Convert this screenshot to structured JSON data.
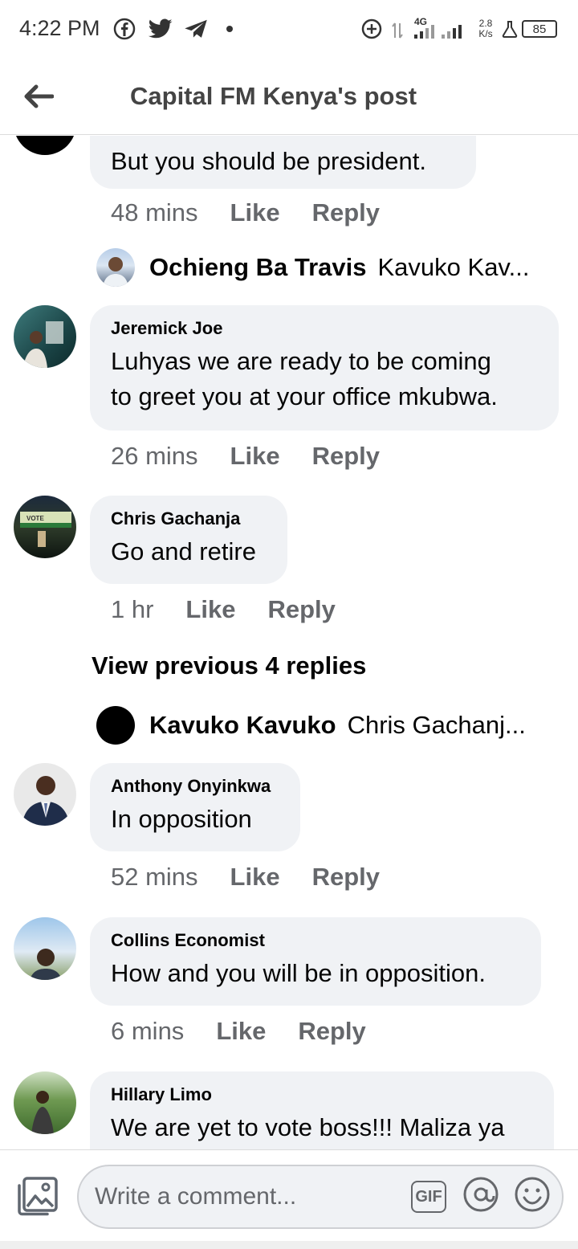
{
  "status_bar": {
    "time": "4:22 PM",
    "network": "4G",
    "speed_value": "2.8",
    "speed_unit": "K/s",
    "battery": "85",
    "icons": [
      "facebook-icon",
      "twitter-icon",
      "telegram-icon",
      "notification-dot-icon",
      "data-saver-icon",
      "signal-icon",
      "lab-icon",
      "battery-icon"
    ]
  },
  "header": {
    "title": "Capital FM Kenya's post",
    "back_icon": "arrow-left-icon"
  },
  "comments": [
    {
      "author": "",
      "text": "But you should be president.",
      "time": "48 mins",
      "like": "Like",
      "reply": "Reply",
      "reply_preview": {
        "name": "Ochieng Ba Travis",
        "text": "Kavuko Kav..."
      }
    },
    {
      "author": "Jeremick Joe",
      "text_lines": [
        "Luhyas we are ready to be coming",
        "to greet you at your office mkubwa."
      ],
      "time": "26 mins",
      "like": "Like",
      "reply": "Reply"
    },
    {
      "author": "Chris Gachanja",
      "text": "Go and retire",
      "time": "1 hr",
      "like": "Like",
      "reply": "Reply",
      "view_previous": "View previous 4 replies",
      "reply_preview": {
        "name": "Kavuko Kavuko",
        "text": "Chris Gachanj..."
      }
    },
    {
      "author": "Anthony Onyinkwa",
      "text": "In opposition",
      "time": "52 mins",
      "like": "Like",
      "reply": "Reply"
    },
    {
      "author": "Collins Economist",
      "text": "How and you will be in opposition.",
      "time": "6 mins",
      "like": "Like",
      "reply": "Reply"
    },
    {
      "author": "Hillary Limo",
      "text": "We are yet to vote boss!!! Maliza ya"
    }
  ],
  "composer": {
    "placeholder": "Write a comment...",
    "gif_label": "GIF",
    "icons": [
      "photo-icon",
      "gif-icon",
      "mention-icon",
      "emoji-icon"
    ]
  },
  "colors": {
    "bubble_bg": "#f0f2f5",
    "secondary_text": "#65676b",
    "primary_text": "#050505"
  }
}
